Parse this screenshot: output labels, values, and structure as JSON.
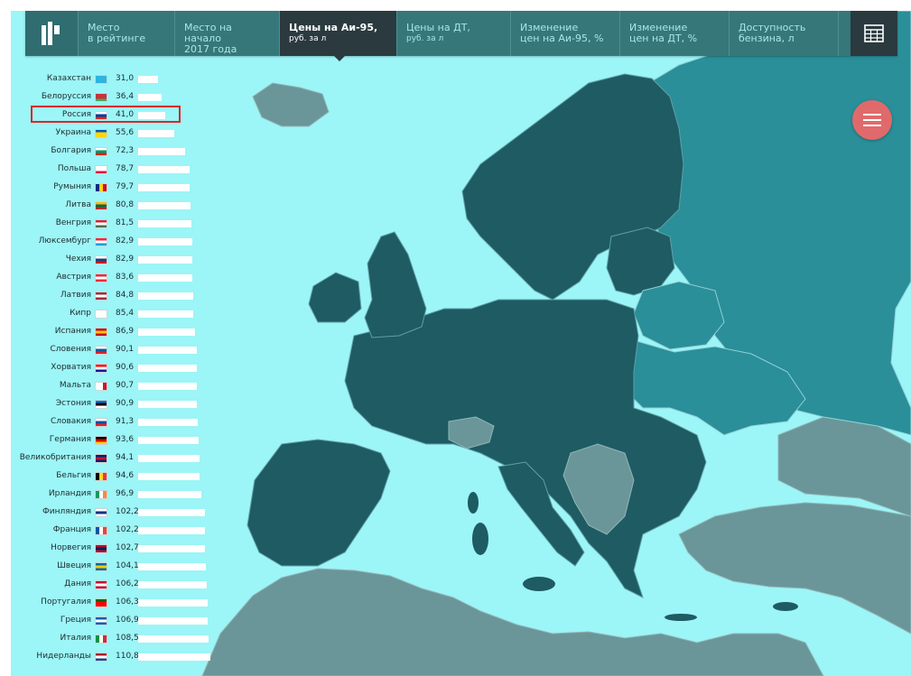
{
  "nav": {
    "tabs": [
      {
        "line1": "Место",
        "line2": "в рейтинге"
      },
      {
        "line1": "Место на начало",
        "line2": "2017 года"
      },
      {
        "line1": "Цены на Аи-95,",
        "line2": "руб. за л"
      },
      {
        "line1": "Цены на ДТ,",
        "line2": "руб. за л"
      },
      {
        "line1": "Изменение",
        "line2": "цен на Аи-95, %"
      },
      {
        "line1": "Изменение",
        "line2": "цен на ДТ, %"
      },
      {
        "line1": "Доступность",
        "line2": "бензина, л"
      }
    ],
    "active_tab_index": 2,
    "logo_icon": "logo-icon",
    "table_icon": "table-icon",
    "menu_icon": "hamburger-icon"
  },
  "colors": {
    "background": "#9cf5f6",
    "nav": "#36777a",
    "nav_active": "#2a3a3f",
    "highlight": "#d9262a",
    "menu_button": "#e06a6b",
    "europe_dark": "#1e5b62",
    "belarus_ukraine": "#2a8f99",
    "other_land": "#6b9699"
  },
  "ranking": {
    "highlighted_country": "Россия",
    "rows": [
      {
        "name": "Казахстан",
        "value": "31,0",
        "v": 31.0,
        "flag": "kz"
      },
      {
        "name": "Белоруссия",
        "value": "36,4",
        "v": 36.4,
        "flag": "by"
      },
      {
        "name": "Россия",
        "value": "41,0",
        "v": 41.0,
        "flag": "ru"
      },
      {
        "name": "Украина",
        "value": "55,6",
        "v": 55.6,
        "flag": "ua"
      },
      {
        "name": "Болгария",
        "value": "72,3",
        "v": 72.3,
        "flag": "bg"
      },
      {
        "name": "Польша",
        "value": "78,7",
        "v": 78.7,
        "flag": "pl"
      },
      {
        "name": "Румыния",
        "value": "79,7",
        "v": 79.7,
        "flag": "ro"
      },
      {
        "name": "Литва",
        "value": "80,8",
        "v": 80.8,
        "flag": "lt"
      },
      {
        "name": "Венгрия",
        "value": "81,5",
        "v": 81.5,
        "flag": "hu"
      },
      {
        "name": "Люксембург",
        "value": "82,9",
        "v": 82.9,
        "flag": "lu"
      },
      {
        "name": "Чехия",
        "value": "82,9",
        "v": 82.9,
        "flag": "cz"
      },
      {
        "name": "Австрия",
        "value": "83,6",
        "v": 83.6,
        "flag": "at"
      },
      {
        "name": "Латвия",
        "value": "84,8",
        "v": 84.8,
        "flag": "lv"
      },
      {
        "name": "Кипр",
        "value": "85,4",
        "v": 85.4,
        "flag": "cy"
      },
      {
        "name": "Испания",
        "value": "86,9",
        "v": 86.9,
        "flag": "es"
      },
      {
        "name": "Словения",
        "value": "90,1",
        "v": 90.1,
        "flag": "si"
      },
      {
        "name": "Хорватия",
        "value": "90,6",
        "v": 90.6,
        "flag": "hr"
      },
      {
        "name": "Мальта",
        "value": "90,7",
        "v": 90.7,
        "flag": "mt"
      },
      {
        "name": "Эстония",
        "value": "90,9",
        "v": 90.9,
        "flag": "ee"
      },
      {
        "name": "Словакия",
        "value": "91,3",
        "v": 91.3,
        "flag": "sk"
      },
      {
        "name": "Германия",
        "value": "93,6",
        "v": 93.6,
        "flag": "de"
      },
      {
        "name": "Великобритания",
        "value": "94,1",
        "v": 94.1,
        "flag": "gb"
      },
      {
        "name": "Бельгия",
        "value": "94,6",
        "v": 94.6,
        "flag": "be"
      },
      {
        "name": "Ирландия",
        "value": "96,9",
        "v": 96.9,
        "flag": "ie"
      },
      {
        "name": "Финляндия",
        "value": "102,2",
        "v": 102.2,
        "flag": "fi"
      },
      {
        "name": "Франция",
        "value": "102,2",
        "v": 102.2,
        "flag": "fr"
      },
      {
        "name": "Норвегия",
        "value": "102,7",
        "v": 102.7,
        "flag": "no"
      },
      {
        "name": "Швеция",
        "value": "104,1",
        "v": 104.1,
        "flag": "se"
      },
      {
        "name": "Дания",
        "value": "106,2",
        "v": 106.2,
        "flag": "dk"
      },
      {
        "name": "Португалия",
        "value": "106,3",
        "v": 106.3,
        "flag": "pt"
      },
      {
        "name": "Греция",
        "value": "106,9",
        "v": 106.9,
        "flag": "gr"
      },
      {
        "name": "Италия",
        "value": "108,5",
        "v": 108.5,
        "flag": "it"
      },
      {
        "name": "Нидерланды",
        "value": "110,8",
        "v": 110.8,
        "flag": "nl"
      }
    ]
  }
}
